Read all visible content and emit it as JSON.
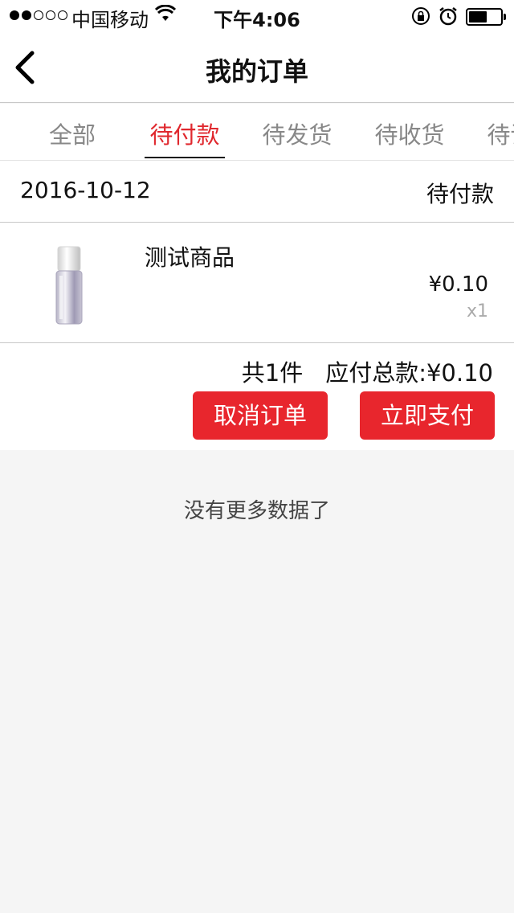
{
  "status_bar": {
    "carrier": "中国移动",
    "time": "下午4:06"
  },
  "nav": {
    "title": "我的订单"
  },
  "tabs": [
    {
      "label": "全部",
      "active": false
    },
    {
      "label": "待付款",
      "active": true
    },
    {
      "label": "待发货",
      "active": false
    },
    {
      "label": "待收货",
      "active": false
    },
    {
      "label": "待评价",
      "active": false
    }
  ],
  "order": {
    "date": "2016-10-12",
    "status": "待付款",
    "item": {
      "name": "测试商品",
      "price": "¥0.10",
      "qty": "x1"
    },
    "count_text": "共1件",
    "total_text": "应付总款:¥0.10",
    "cancel_label": "取消订单",
    "pay_label": "立即支付"
  },
  "footer_text": "没有更多数据了",
  "colors": {
    "accent": "#e8262d",
    "active_tab": "#e0282e"
  }
}
